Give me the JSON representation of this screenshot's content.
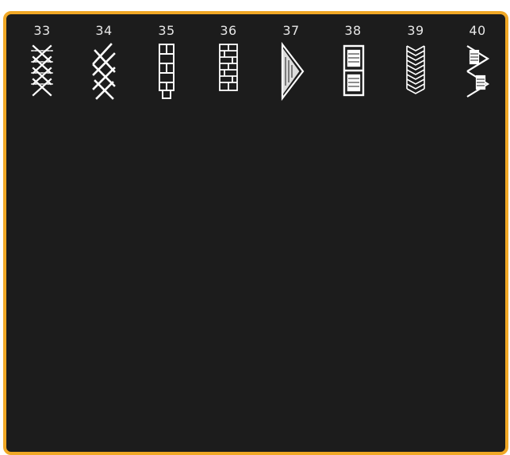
{
  "accent_color": "#f0a826",
  "background_color": "#1c1c1c",
  "stitches": [
    {
      "number": "33",
      "icon": "braid-cross-stitch-icon"
    },
    {
      "number": "34",
      "icon": "double-cross-stitch-icon"
    },
    {
      "number": "35",
      "icon": "ladder-brick-stitch-icon"
    },
    {
      "number": "36",
      "icon": "brick-block-stitch-icon"
    },
    {
      "number": "37",
      "icon": "triangle-fill-stitch-icon"
    },
    {
      "number": "38",
      "icon": "square-fill-stitch-icon"
    },
    {
      "number": "39",
      "icon": "zigzag-column-stitch-icon"
    },
    {
      "number": "40",
      "icon": "bowtie-fill-stitch-icon"
    }
  ]
}
